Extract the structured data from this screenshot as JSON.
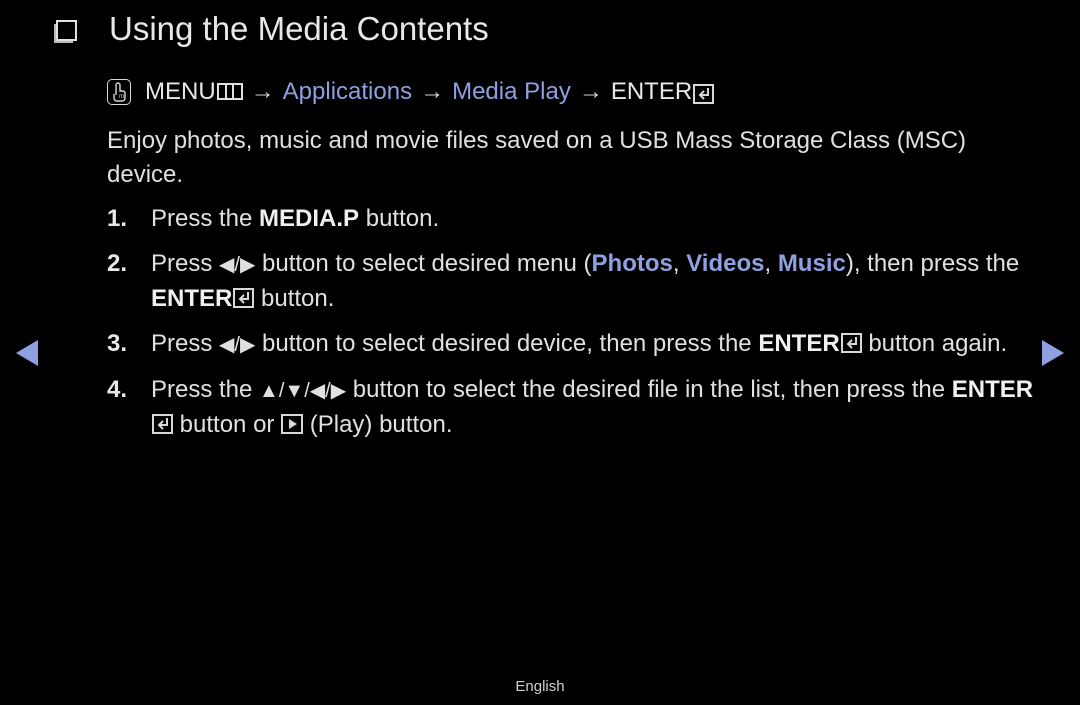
{
  "title": "Using the Media Contents",
  "menu_path": {
    "menu_label": "MENU",
    "arrow": "→",
    "applications": "Applications",
    "media_play": "Media Play",
    "enter_label": "ENTER"
  },
  "intro": "Enjoy photos, music and movie files saved on a USB Mass Storage Class (MSC) device.",
  "steps": [
    {
      "num": "1.",
      "pre": "Press the ",
      "button": "MEDIA.P",
      "post": " button."
    },
    {
      "num": "2.",
      "pre": "Press ",
      "arrows": "◀/▶",
      "mid": " button to select desired menu (",
      "opt1": "Photos",
      "sep1": ", ",
      "opt2": "Videos",
      "sep2": ", ",
      "opt3": "Music",
      "mid2": "), then press the ",
      "button": "ENTER",
      "post": " button."
    },
    {
      "num": "3.",
      "pre": "Press ",
      "arrows": "◀/▶",
      "mid": " button to select desired device, then press the ",
      "button": "ENTER",
      "post": " button again."
    },
    {
      "num": "4.",
      "pre": "Press the ",
      "arrows": "▲/▼/◀/▶",
      "mid": " button to select the desired file in the list, then press the ",
      "button": "ENTER",
      "mid2": " button or ",
      "post": " (Play) button."
    }
  ],
  "footer": "English",
  "colors": {
    "accent": "#8ea0e0",
    "text": "#e0e0e0",
    "background": "#000000"
  }
}
